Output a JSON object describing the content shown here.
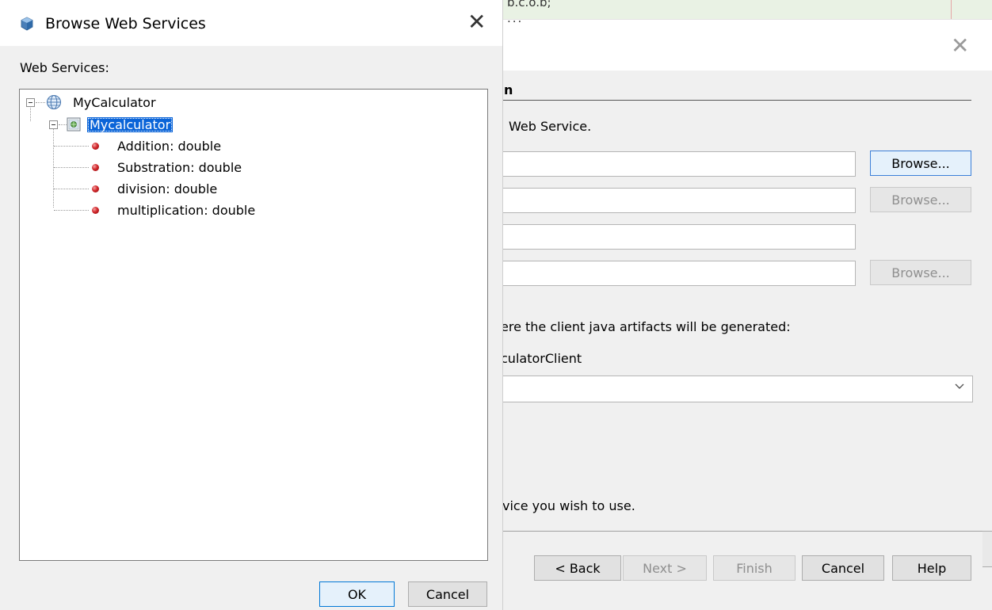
{
  "browse_dialog": {
    "title": "Browse Web Services",
    "list_label": "Web Services:",
    "tree": {
      "root": "MyCalculator",
      "service": "Mycalculator",
      "operations": [
        "Addition: double",
        "Substration: double",
        "division: double",
        "multiplication: double"
      ]
    },
    "ok_label": "OK",
    "cancel_label": "Cancel",
    "close_glyph": "✕"
  },
  "wizard": {
    "scrap_text": "b.c.o.b;",
    "scrap_text2": "...",
    "close_glyph": "✕",
    "section_title_fragment": "n",
    "web_service_text": "Web Service.",
    "browse_label": "Browse...",
    "package_text": "ere the client java artifacts will be generated:",
    "client_text": "culatorClient",
    "bottom_text": "vice you wish to use.",
    "buttons": {
      "back": "< Back",
      "next": "Next >",
      "finish": "Finish",
      "cancel": "Cancel",
      "help": "Help"
    }
  },
  "icons": {
    "title_icon": "cube-icon",
    "root_icon": "globe-icon",
    "service_icon": "web-service-icon",
    "operation_icon": "red-ball-icon"
  },
  "colors": {
    "selection": "#0a64d8",
    "dialog_bg": "#f0f0f0"
  }
}
